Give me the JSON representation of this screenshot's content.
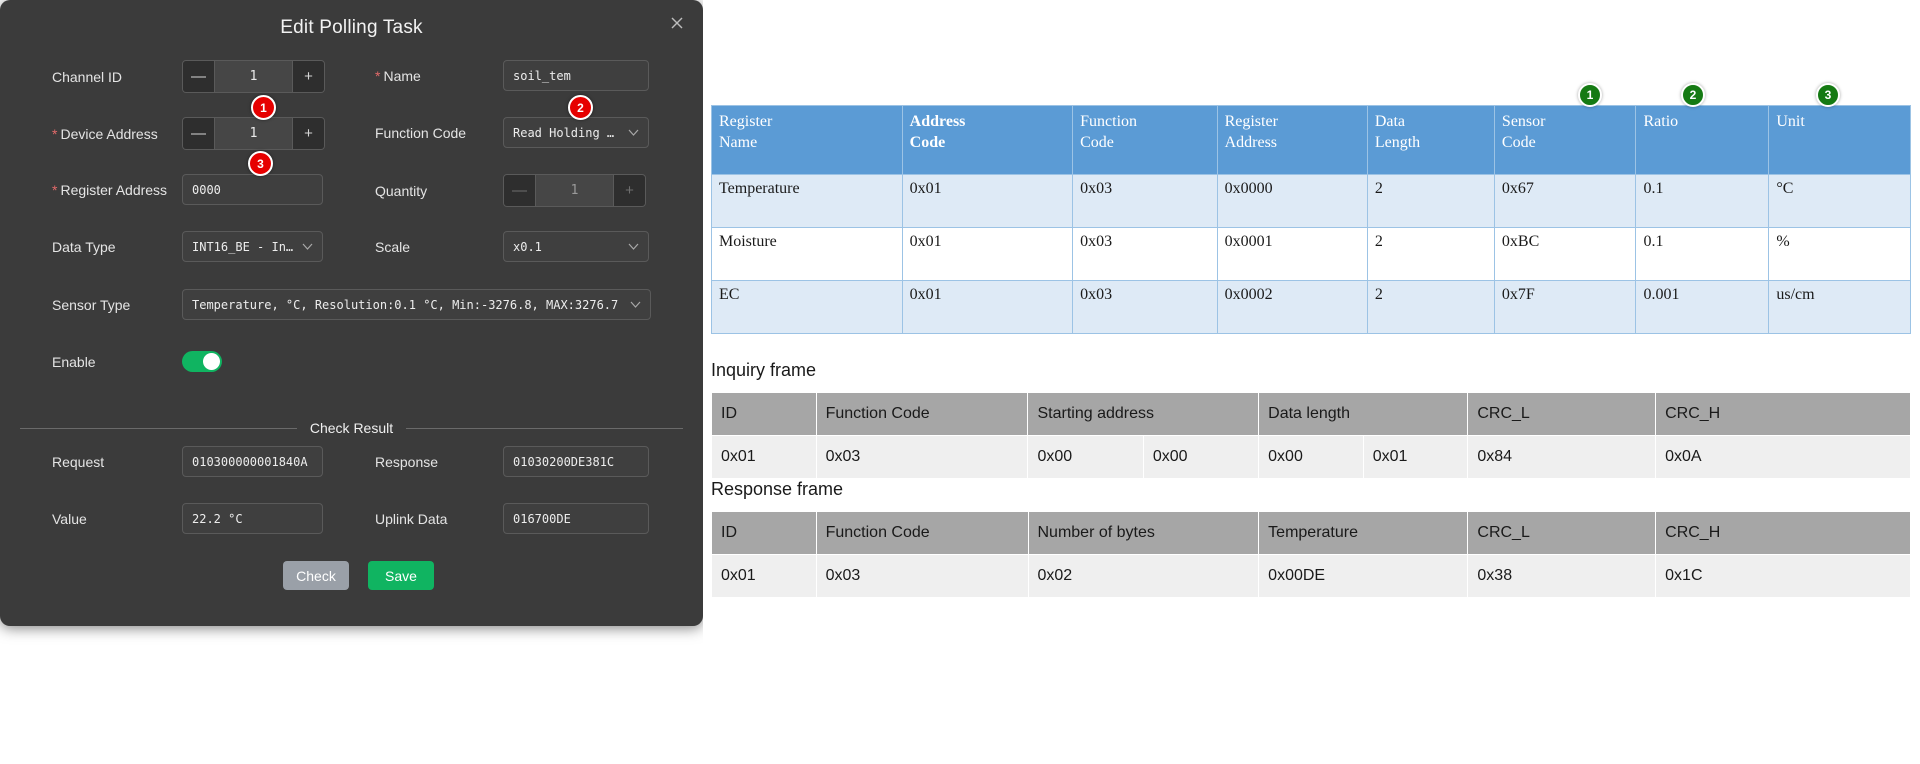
{
  "dialog": {
    "title": "Edit Polling Task",
    "close_icon": "close-icon",
    "fields": {
      "channel_id_label": "Channel ID",
      "channel_id_value": "1",
      "name_label": "Name",
      "name_value": "soil_tem",
      "device_address_label": "Device Address",
      "device_address_value": "1",
      "function_code_label": "Function Code",
      "function_code_value": "Read Holding Re…",
      "register_address_label": "Register Address",
      "register_address_value": "0000",
      "quantity_label": "Quantity",
      "quantity_value": "1",
      "data_type_label": "Data Type",
      "data_type_value": "INT16_BE - Inte…",
      "scale_label": "Scale",
      "scale_value": "x0.1",
      "sensor_type_label": "Sensor Type",
      "sensor_type_value": "Temperature, °C, Resolution:0.1 °C, Min:-3276.8, MAX:3276.7",
      "enable_label": "Enable",
      "enable_state": "on",
      "minus_icon": "—",
      "plus_icon": "+",
      "caret_icon": "∨"
    },
    "check_result": {
      "section_title": "Check Result",
      "request_label": "Request",
      "request_value": "010300000001840A",
      "response_label": "Response",
      "response_value": "01030200DE381C",
      "value_label": "Value",
      "value_value": "22.2 °C",
      "uplink_label": "Uplink Data",
      "uplink_value": "016700DE"
    },
    "buttons": {
      "check": "Check",
      "save": "Save"
    },
    "badges": [
      {
        "id": "badge-1",
        "label": "1"
      },
      {
        "id": "badge-2",
        "label": "2"
      },
      {
        "id": "badge-3",
        "label": "3"
      }
    ]
  },
  "right_panel": {
    "green_badges": [
      {
        "label": "1"
      },
      {
        "label": "2"
      },
      {
        "label": "3"
      }
    ],
    "register_table": {
      "headers": [
        {
          "line1": "Register",
          "line2": "Name",
          "bold": false
        },
        {
          "line1": "Address",
          "line2": "Code",
          "bold": true
        },
        {
          "line1": "Function",
          "line2": "Code",
          "bold": false
        },
        {
          "line1": "Register",
          "line2": "Address",
          "bold": false
        },
        {
          "line1": "Data",
          "line2": "Length",
          "bold": false
        },
        {
          "line1": "Sensor",
          "line2": "Code",
          "bold": false
        },
        {
          "line1": "Ratio",
          "line2": "",
          "bold": false
        },
        {
          "line1": "Unit",
          "line2": "",
          "bold": false
        }
      ],
      "rows": [
        [
          "Temperature",
          "0x01",
          "0x03",
          "0x0000",
          "2",
          "0x67",
          "0.1",
          "°C"
        ],
        [
          "Moisture",
          "0x01",
          "0x03",
          "0x0001",
          "2",
          "0xBC",
          "0.1",
          "%"
        ],
        [
          "EC",
          "0x01",
          "0x03",
          "0x0002",
          "2",
          "0x7F",
          "0.001",
          "us/cm"
        ]
      ]
    },
    "inquiry_frame": {
      "caption": "Inquiry frame",
      "headers": [
        "ID",
        "Function Code",
        "Starting address",
        "Data length",
        "CRC_L",
        "CRC_H"
      ],
      "row": [
        "0x01",
        "0x03",
        "0x00",
        "0x00",
        "0x00",
        "0x01",
        "0x84",
        "0x0A"
      ]
    },
    "response_frame": {
      "caption": "Response frame",
      "headers": [
        "ID",
        "Function Code",
        "Number of bytes",
        "Temperature",
        "CRC_L",
        "CRC_H"
      ],
      "row": [
        "0x01",
        "0x03",
        "0x02",
        "0x00DE",
        "0x38",
        "0x1C"
      ]
    }
  }
}
